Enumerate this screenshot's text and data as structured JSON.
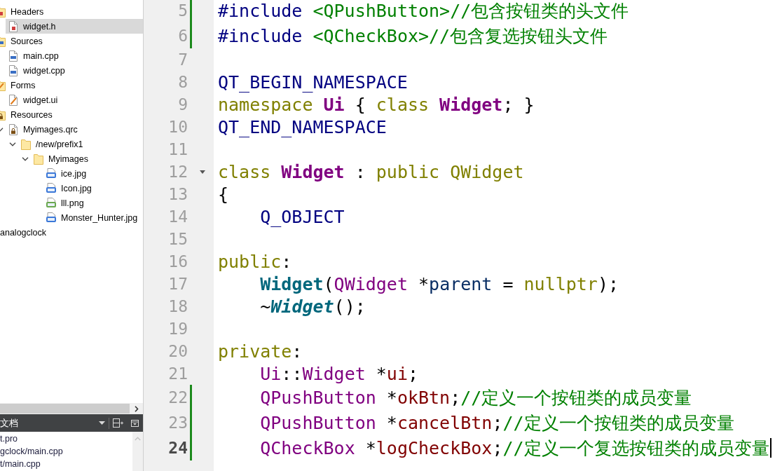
{
  "project_tree": [
    {
      "label": "Headers",
      "kind": "headers-folder",
      "selected": false,
      "children": [
        {
          "label": "widget.h",
          "kind": "header-file",
          "selected": true
        }
      ]
    },
    {
      "label": "Sources",
      "kind": "sources-folder",
      "selected": false,
      "children": [
        {
          "label": "main.cpp",
          "kind": "source-file",
          "selected": false
        },
        {
          "label": "widget.cpp",
          "kind": "source-file",
          "selected": false
        }
      ]
    },
    {
      "label": "Forms",
      "kind": "forms-folder",
      "selected": false,
      "children": [
        {
          "label": "widget.ui",
          "kind": "form-file",
          "selected": false
        }
      ]
    },
    {
      "label": "Resources",
      "kind": "resources-folder",
      "selected": false,
      "children": [
        {
          "label": "Myimages.qrc",
          "kind": "qrc-file",
          "selected": false,
          "expanded": true,
          "children": [
            {
              "label": "/new/prefix1",
              "kind": "folder",
              "selected": false,
              "expanded": true,
              "children": [
                {
                  "label": "Myimages",
                  "kind": "folder",
                  "selected": false,
                  "expanded": true,
                  "children": [
                    {
                      "label": "ice.jpg",
                      "kind": "jpg-file",
                      "selected": false
                    },
                    {
                      "label": "Icon.jpg",
                      "kind": "jpg-file",
                      "selected": false
                    },
                    {
                      "label": "lll.png",
                      "kind": "png-file",
                      "selected": false
                    },
                    {
                      "label": "Monster_Hunter.jpg",
                      "kind": "jpg-file",
                      "selected": false
                    }
                  ]
                }
              ]
            }
          ]
        }
      ]
    }
  ],
  "other_projects": [
    {
      "label": "analogclock",
      "selected": false
    }
  ],
  "open_documents": {
    "title": "文档",
    "items": [
      {
        "label": "t.pro"
      },
      {
        "label": "gclock/main.cpp"
      },
      {
        "label": "t/main.cpp"
      }
    ]
  },
  "editor": {
    "lines": [
      {
        "number": "5",
        "changed": true,
        "current": false,
        "foldable": false,
        "tokens": [
          {
            "text": "#include ",
            "kind": "directive"
          },
          {
            "text": "<QPushButton>",
            "kind": "include_path"
          },
          {
            "text": "//包含按钮类的头文件",
            "kind": "comment"
          }
        ]
      },
      {
        "number": "6",
        "changed": true,
        "current": false,
        "foldable": false,
        "tokens": [
          {
            "text": "#include ",
            "kind": "directive"
          },
          {
            "text": "<QCheckBox>",
            "kind": "include_path"
          },
          {
            "text": "//包含复选按钮头文件",
            "kind": "comment"
          }
        ]
      },
      {
        "number": "7",
        "changed": false,
        "current": false,
        "foldable": false
      },
      {
        "number": "8",
        "changed": false,
        "current": false,
        "foldable": false,
        "tokens": [
          {
            "text": "QT_BEGIN_NAMESPACE",
            "kind": "macro"
          }
        ]
      },
      {
        "number": "9",
        "changed": false,
        "current": false,
        "foldable": false,
        "tokens": [
          {
            "text": "namespace ",
            "kind": "keyword"
          },
          {
            "text": "Ui",
            "kind": "class_name"
          },
          {
            "text": " { ",
            "kind": "plain"
          },
          {
            "text": "class ",
            "kind": "keyword"
          },
          {
            "text": "Widget",
            "kind": "class_name"
          },
          {
            "text": "; }",
            "kind": "plain"
          }
        ]
      },
      {
        "number": "10",
        "changed": false,
        "current": false,
        "foldable": false,
        "tokens": [
          {
            "text": "QT_END_NAMESPACE",
            "kind": "macro"
          }
        ]
      },
      {
        "number": "11",
        "changed": false,
        "current": false,
        "foldable": false
      },
      {
        "number": "12",
        "changed": false,
        "current": false,
        "foldable": true,
        "tokens": [
          {
            "text": "class ",
            "kind": "keyword"
          },
          {
            "text": "Widget",
            "kind": "class_name"
          },
          {
            "text": " : ",
            "kind": "plain"
          },
          {
            "text": "public ",
            "kind": "keyword"
          },
          {
            "text": "QWidget",
            "kind": "base_class"
          }
        ]
      },
      {
        "number": "13",
        "changed": false,
        "current": false,
        "foldable": false,
        "tokens": [
          {
            "text": "{",
            "kind": "plain"
          }
        ]
      },
      {
        "number": "14",
        "changed": false,
        "current": false,
        "foldable": false,
        "tokens": [
          {
            "text": "    Q_OBJECT",
            "kind": "macro"
          }
        ]
      },
      {
        "number": "15",
        "changed": false,
        "current": false,
        "foldable": false
      },
      {
        "number": "16",
        "changed": false,
        "current": false,
        "foldable": false,
        "tokens": [
          {
            "text": "public",
            "kind": "keyword"
          },
          {
            "text": ":",
            "kind": "plain"
          }
        ]
      },
      {
        "number": "17",
        "changed": false,
        "current": false,
        "foldable": false,
        "tokens": [
          {
            "text": "    Widget",
            "kind": "function"
          },
          {
            "text": "(",
            "kind": "plain"
          },
          {
            "text": "QWidget ",
            "kind": "type"
          },
          {
            "text": "*",
            "kind": "plain"
          },
          {
            "text": "parent",
            "kind": "parameter"
          },
          {
            "text": " = ",
            "kind": "plain"
          },
          {
            "text": "nullptr",
            "kind": "keyword"
          },
          {
            "text": ");",
            "kind": "plain"
          }
        ]
      },
      {
        "number": "18",
        "changed": false,
        "current": false,
        "foldable": false,
        "tokens": [
          {
            "text": "    ~",
            "kind": "plain"
          },
          {
            "text": "Widget",
            "kind": "virtual_function"
          },
          {
            "text": "();",
            "kind": "plain"
          }
        ]
      },
      {
        "number": "19",
        "changed": false,
        "current": false,
        "foldable": false
      },
      {
        "number": "20",
        "changed": false,
        "current": false,
        "foldable": false,
        "tokens": [
          {
            "text": "private",
            "kind": "keyword"
          },
          {
            "text": ":",
            "kind": "plain"
          }
        ]
      },
      {
        "number": "21",
        "changed": false,
        "current": false,
        "foldable": false,
        "tokens": [
          {
            "text": "    Ui",
            "kind": "type"
          },
          {
            "text": "::",
            "kind": "plain"
          },
          {
            "text": "Widget ",
            "kind": "type"
          },
          {
            "text": "*",
            "kind": "plain"
          },
          {
            "text": "ui",
            "kind": "field"
          },
          {
            "text": ";",
            "kind": "plain"
          }
        ]
      },
      {
        "number": "22",
        "changed": true,
        "current": false,
        "foldable": false,
        "tokens": [
          {
            "text": "    QPushButton ",
            "kind": "type"
          },
          {
            "text": "*",
            "kind": "plain"
          },
          {
            "text": "okBtn",
            "kind": "field"
          },
          {
            "text": ";",
            "kind": "plain"
          },
          {
            "text": "//定义一个按钮类的成员变量",
            "kind": "comment"
          }
        ]
      },
      {
        "number": "23",
        "changed": true,
        "current": false,
        "foldable": false,
        "tokens": [
          {
            "text": "    QPushButton ",
            "kind": "type"
          },
          {
            "text": "*",
            "kind": "plain"
          },
          {
            "text": "cancelBtn",
            "kind": "field"
          },
          {
            "text": ";",
            "kind": "plain"
          },
          {
            "text": "//定义一个按钮类的成员变量",
            "kind": "comment"
          }
        ]
      },
      {
        "number": "24",
        "changed": true,
        "current": true,
        "foldable": false,
        "tokens": [
          {
            "text": "    QCheckBox ",
            "kind": "type"
          },
          {
            "text": "*",
            "kind": "plain"
          },
          {
            "text": "logCheckBox",
            "kind": "field"
          },
          {
            "text": ";",
            "kind": "plain"
          },
          {
            "text": "//定义一个复选按钮类的成员变量",
            "kind": "comment"
          }
        ]
      }
    ]
  }
}
